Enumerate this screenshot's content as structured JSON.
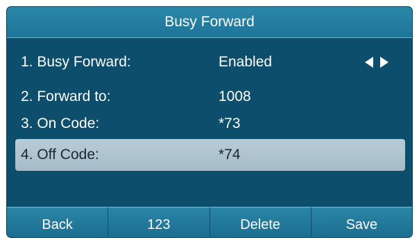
{
  "screen": {
    "title": "Busy Forward"
  },
  "rows": [
    {
      "label": "1. Busy Forward:",
      "value": "Enabled"
    },
    {
      "label": "2. Forward to:",
      "value": "1008"
    },
    {
      "label": "3. On Code:",
      "value": "*73"
    },
    {
      "label": "4. Off Code:",
      "value": "*74",
      "selected": true
    }
  ],
  "icons": {
    "left_arrow": "left-arrow-icon",
    "right_arrow": "right-arrow-icon"
  },
  "softkeys": [
    "Back",
    "123",
    "Delete",
    "Save"
  ],
  "colors": {
    "background": "#0d4e6c",
    "title_bar": "#1e7598",
    "selected_row": "#b8ccd6",
    "softkey": "#2a85a6"
  }
}
